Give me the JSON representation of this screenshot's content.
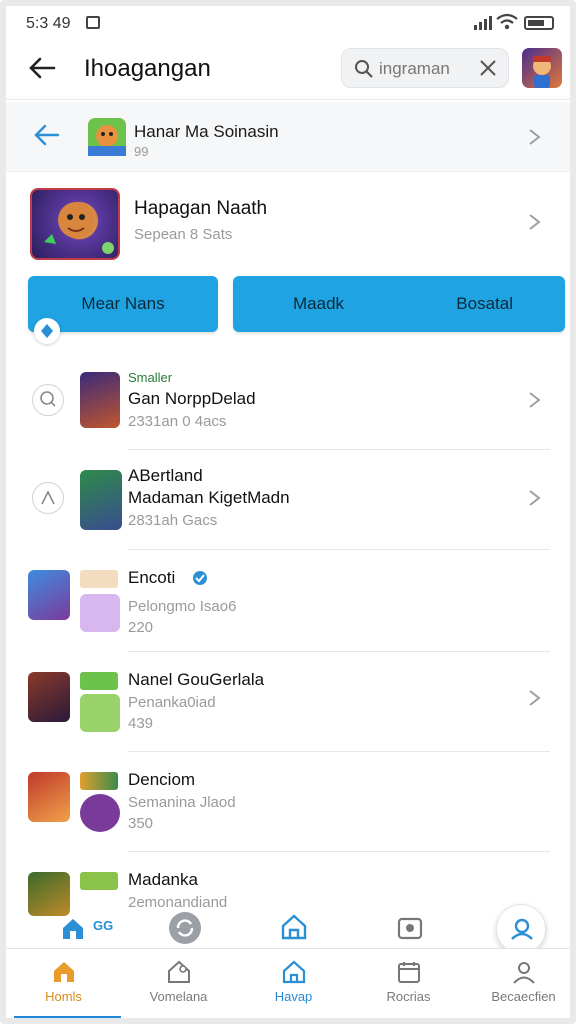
{
  "status": {
    "time": "5:3 49"
  },
  "appbar": {
    "title": "Ihoagangan",
    "search_value": "ingraman"
  },
  "header": {
    "name": "Hanar Ma Soinasin",
    "sub": "99"
  },
  "featured": {
    "name": "Hapagan Naath",
    "sub": "Sepean 8 Sats",
    "button_left": "Mear Nans",
    "button_mid": "Maadk",
    "button_right": "Bosatal"
  },
  "rows": [
    {
      "small": "Smaller",
      "title": "Gan NorppDelad",
      "sub": "2331an 0 4acs",
      "extra": ""
    },
    {
      "small": "",
      "title": "ABertland",
      "title2": "Madaman KigetMadn",
      "sub": "2831ah Gacs"
    },
    {
      "small": "",
      "title": "Encoti",
      "sub": "Pelongmo Isao6",
      "extra": "220"
    },
    {
      "small": "",
      "title": "Nanel GouGerlala",
      "sub": "Penanka0iad",
      "extra": "439"
    },
    {
      "small": "",
      "title": "Denciom",
      "sub": "Semanina Jlaod",
      "extra": "350"
    },
    {
      "small": "",
      "title": "Madanka",
      "sub": "2emonandiand",
      "extra": ""
    }
  ],
  "quick": {
    "label": "GG"
  },
  "nav": [
    {
      "label": "Homls"
    },
    {
      "label": "Vomelana"
    },
    {
      "label": "Havap"
    },
    {
      "label": "Rocrias"
    },
    {
      "label": "Becaecfien"
    }
  ],
  "colors": {
    "accent": "#1fa3e2",
    "active_tab": "#d88a1a",
    "nav_indicator": "#1e88d6"
  }
}
